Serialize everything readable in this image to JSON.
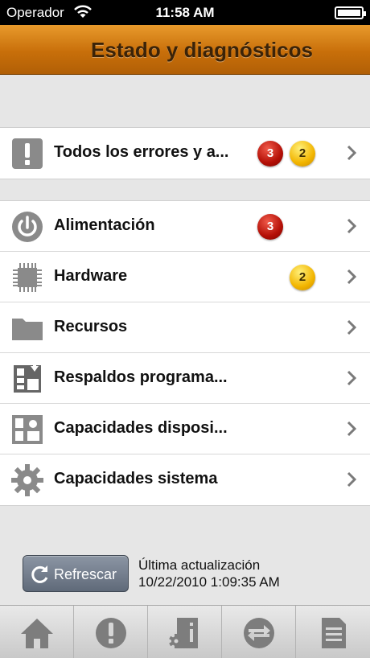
{
  "status_bar": {
    "carrier": "Operador",
    "time": "11:58 AM"
  },
  "nav": {
    "title": "Estado y diagnósticos"
  },
  "groups": [
    {
      "rows": [
        {
          "label": "Todos los errores y a...",
          "icon": "exclamation-icon",
          "badges": [
            {
              "value": "3",
              "color": "red"
            },
            {
              "value": "2",
              "color": "yellow"
            }
          ]
        }
      ]
    },
    {
      "rows": [
        {
          "label": "Alimentación",
          "icon": "power-icon",
          "badges": [
            {
              "value": "3",
              "color": "red"
            }
          ]
        },
        {
          "label": "Hardware",
          "icon": "chip-icon",
          "badges": [
            {
              "value": "2",
              "color": "yellow"
            }
          ]
        },
        {
          "label": "Recursos",
          "icon": "folder-icon",
          "badges": []
        },
        {
          "label": "Respaldos programa...",
          "icon": "backup-icon",
          "badges": []
        },
        {
          "label": "Capacidades disposi...",
          "icon": "device-capabilities-icon",
          "badges": []
        },
        {
          "label": "Capacidades sistema",
          "icon": "gear-icon",
          "badges": []
        }
      ]
    }
  ],
  "footer": {
    "refresh_label": "Refrescar",
    "last_update_label": "Última actualización",
    "last_update_value": "10/22/2010 1:09:35 AM"
  },
  "tabs": [
    {
      "icon": "home-icon"
    },
    {
      "icon": "exclamation-circle-icon"
    },
    {
      "icon": "device-info-icon"
    },
    {
      "icon": "sync-arrows-icon"
    },
    {
      "icon": "document-icon"
    }
  ]
}
